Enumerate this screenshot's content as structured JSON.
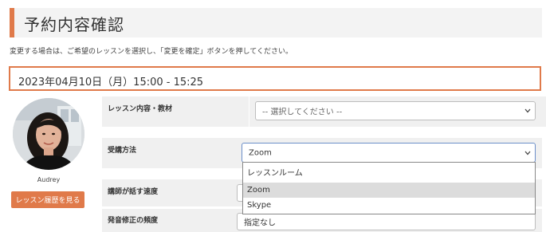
{
  "header": {
    "title": "予約内容確認"
  },
  "instruction": "変更する場合は、ご希望のレッスンを選択し、「変更を確定」ボタンを押してください。",
  "booking": {
    "datetime": "2023年04月10日（月）15:00 - 15:25"
  },
  "teacher": {
    "name": "Audrey",
    "history_button": "レッスン履歴を見る"
  },
  "form": {
    "lesson_content": {
      "label": "レッスン内容・教材",
      "value": "-- 選択してください --"
    },
    "method": {
      "label": "受講方法",
      "value": "Zoom",
      "options": [
        "レッスンルーム",
        "Zoom",
        "Skype"
      ],
      "highlighted_option": "Zoom"
    },
    "speed": {
      "label": "講師が話す速度"
    },
    "correction": {
      "label": "発音修正の頻度",
      "value": "指定なし"
    }
  },
  "colors": {
    "accent": "#e07a4a",
    "panel": "#f0f0f0"
  },
  "icons": {
    "select_arrow": "chevron-down-icon"
  }
}
